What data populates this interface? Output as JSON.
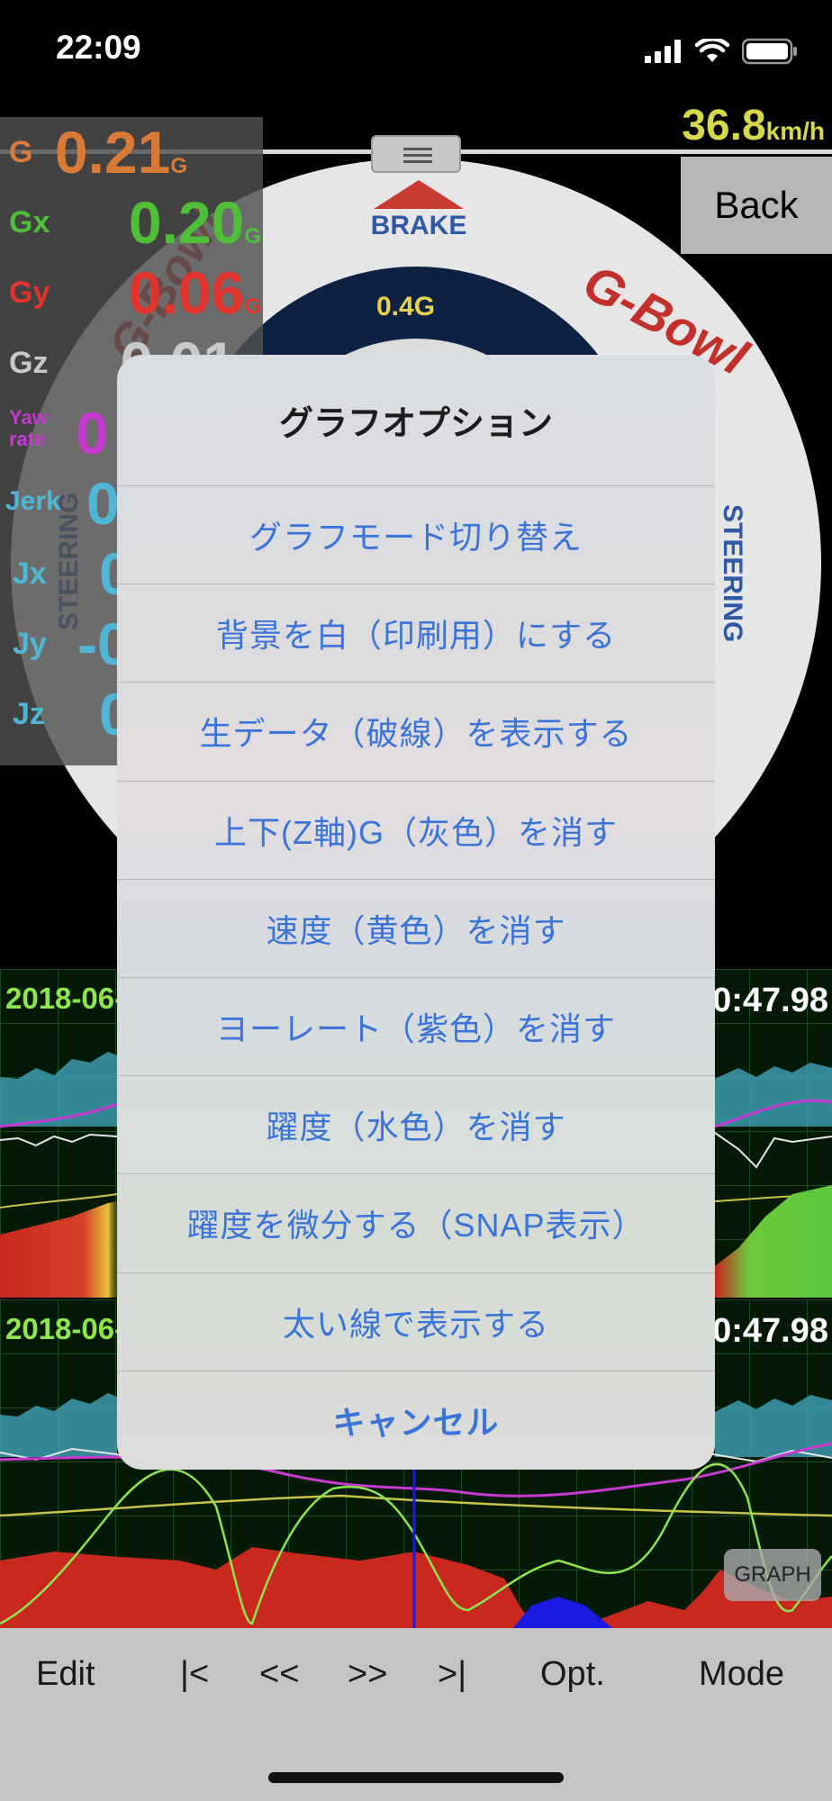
{
  "status_bar": {
    "time": "22:09"
  },
  "speed": {
    "value": "36.8",
    "unit": "km/h"
  },
  "back_label": "Back",
  "bowl": {
    "brake": "BRAKE",
    "scale": "0.4G",
    "steering": "STEERING",
    "logo": "G-Bowl"
  },
  "readings": [
    {
      "label": "G",
      "value": "0.21",
      "unit": "G",
      "color": "#d87a38"
    },
    {
      "label": "Gx",
      "value": "0.20",
      "unit": "G",
      "color": "#4fbf3a"
    },
    {
      "label": "Gy",
      "value": "0.06",
      "unit": "G",
      "color": "#e2342c"
    },
    {
      "label": "Gz",
      "value": "0.01",
      "unit": "",
      "color": "#c9c9c9"
    },
    {
      "label": "Yaw rate",
      "value": "0",
      "unit": "",
      "color": "#c63ad1"
    },
    {
      "label": "Jerk",
      "value": "0",
      "unit": "",
      "color": "#4fb6d6"
    },
    {
      "label": "Jx",
      "value": "0",
      "unit": "",
      "color": "#4fb6d6"
    },
    {
      "label": "Jy",
      "value": "-0",
      "unit": "",
      "color": "#4fb6d6"
    },
    {
      "label": "Jz",
      "value": "0",
      "unit": "",
      "color": "#4fb6d6"
    }
  ],
  "graphs": [
    {
      "date": "2018-06-",
      "time": "0:47.98"
    },
    {
      "date": "2018-06-",
      "time": "0:47.98"
    }
  ],
  "graph_button": "GRAPH",
  "action_sheet": {
    "title": "グラフオプション",
    "items": [
      "グラフモード切り替え",
      "背景を白（印刷用）にする",
      "生データ（破線）を表示する",
      "上下(Z軸)G（灰色）を消す",
      "速度（黄色）を消す",
      "ヨーレート（紫色）を消す",
      "躍度（水色）を消す",
      "躍度を微分する（SNAP表示）",
      "太い線で表示する"
    ],
    "cancel": "キャンセル"
  },
  "toolbar": {
    "edit": "Edit",
    "first": "|<",
    "prev": "<<",
    "next": ">>",
    "last": ">|",
    "options": "Opt.",
    "mode": "Mode"
  },
  "colors": {
    "accent_blue": "#3a74d8",
    "speed_yellow": "#d7d84a",
    "graph_green": "#8ee64f"
  }
}
